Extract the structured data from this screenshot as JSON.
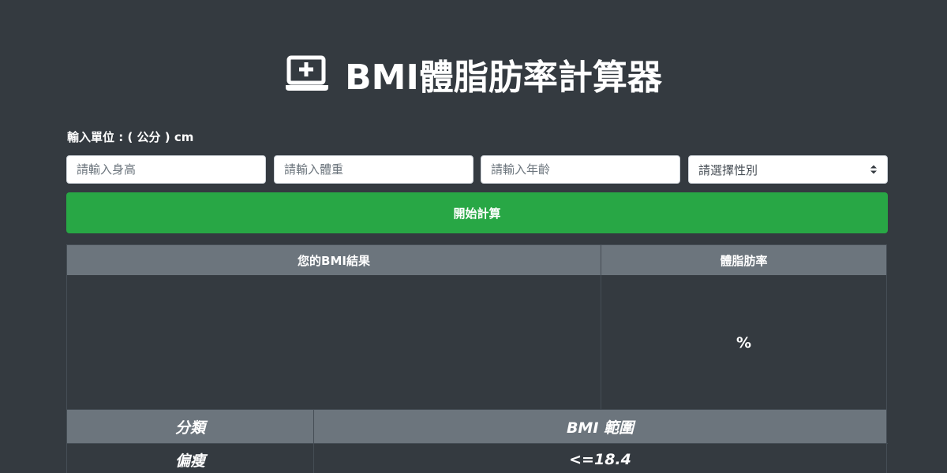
{
  "header": {
    "title": "BMI體脂肪率計算器",
    "icon": "laptop-medical-icon"
  },
  "form": {
    "unit_label": "輸入單位 : ( 公分 ) cm",
    "height_placeholder": "請輸入身高",
    "weight_placeholder": "請輸入體重",
    "age_placeholder": "請輸入年齡",
    "gender_select": "請選擇性別",
    "calculate_label": "開始計算"
  },
  "result_table": {
    "bmi_header": "您的BMI結果",
    "bodyfat_header": "體脂肪率",
    "bmi_value": "",
    "bodyfat_value": "%"
  },
  "range_table": {
    "headers": [
      "分類",
      "BMI 範圍"
    ],
    "rows": [
      [
        "偏瘦",
        "<=18.4"
      ]
    ]
  },
  "colors": {
    "background": "#343a40",
    "header_cell": "#6c757d",
    "button": "#28a745"
  }
}
